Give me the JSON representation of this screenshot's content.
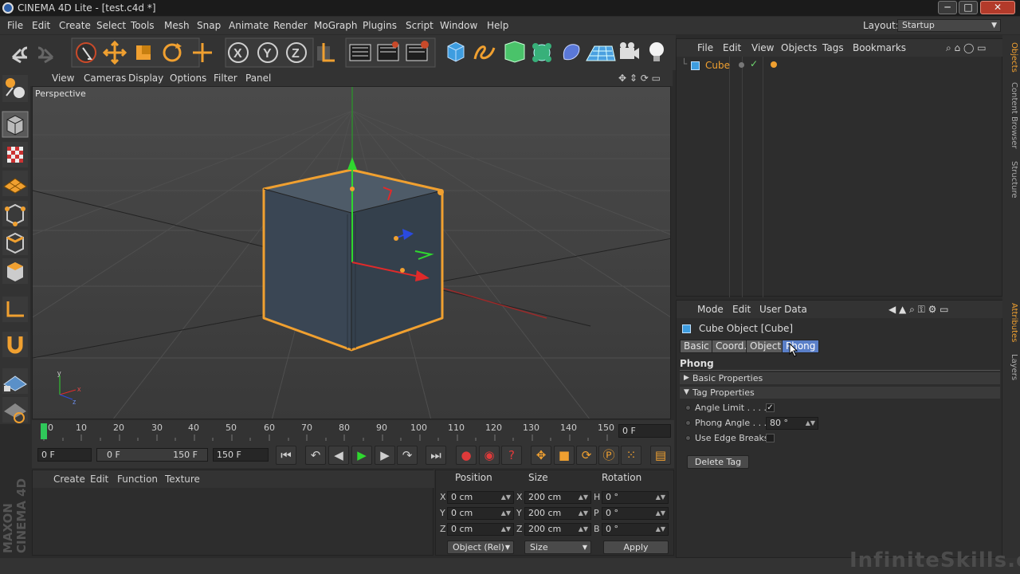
{
  "window": {
    "title": "CINEMA 4D Lite - [test.c4d *]",
    "min": "─",
    "max": "□",
    "close": "✕"
  },
  "menu": {
    "items": [
      "File",
      "Edit",
      "Create",
      "Select",
      "Tools",
      "Mesh",
      "Snap",
      "Animate",
      "Render",
      "MoGraph",
      "Plugins",
      "Script",
      "Window",
      "Help"
    ],
    "layout_label": "Layout:",
    "layout_value": "Startup"
  },
  "viewport": {
    "menu": [
      "View",
      "Cameras",
      "Display",
      "Options",
      "Filter",
      "Panel"
    ],
    "label": "Perspective"
  },
  "timeline": {
    "ticks": [
      "0",
      "10",
      "20",
      "30",
      "40",
      "50",
      "60",
      "70",
      "80",
      "90",
      "100",
      "110",
      "120",
      "130",
      "140",
      "150"
    ],
    "current": "0 F"
  },
  "playbar": {
    "start": "0 F",
    "range_start": "0 F",
    "range_end": "150 F",
    "end": "150 F"
  },
  "materials": {
    "menu": [
      "Create",
      "Edit",
      "Function",
      "Texture"
    ]
  },
  "coords": {
    "headers": [
      "Position",
      "Size",
      "Rotation"
    ],
    "rows": [
      {
        "pl": "X",
        "pv": "0 cm",
        "sl": "X",
        "sv": "200 cm",
        "rl": "H",
        "rv": "0 °"
      },
      {
        "pl": "Y",
        "pv": "0 cm",
        "sl": "Y",
        "sv": "200 cm",
        "rl": "P",
        "rv": "0 °"
      },
      {
        "pl": "Z",
        "pv": "0 cm",
        "sl": "Z",
        "sv": "200 cm",
        "rl": "B",
        "rv": "0 °"
      }
    ],
    "mode": "Object (Rel)",
    "size_mode": "Size",
    "apply": "Apply"
  },
  "objects": {
    "menu": [
      "File",
      "Edit",
      "View",
      "Objects",
      "Tags",
      "Bookmarks"
    ],
    "items": [
      {
        "name": "Cube"
      }
    ]
  },
  "attributes": {
    "menu": [
      "Mode",
      "Edit",
      "User Data"
    ],
    "object_title": "Cube Object [Cube]",
    "tabs": [
      "Basic",
      "Coord.",
      "Object",
      "Phong"
    ],
    "active_tab": "Phong",
    "section_title": "Phong",
    "groups": [
      "Basic Properties",
      "Tag Properties"
    ],
    "props": [
      {
        "label": "Angle Limit . . . . .",
        "value": "✓"
      },
      {
        "label": "Phong Angle . . .",
        "value": "80 °"
      },
      {
        "label": "Use Edge Breaks",
        "value": ""
      }
    ],
    "delete_tag": "Delete Tag"
  },
  "side_tabs": [
    "Objects",
    "Content Browser",
    "Structure",
    "Attributes",
    "Layers"
  ],
  "watermark": "InfiniteSkills.com",
  "logo": "MAXON CINEMA 4D",
  "colors": {
    "accent": "#f0a030",
    "selected_tab": "#5a7fc8",
    "cube_face": "#3c4a58"
  }
}
